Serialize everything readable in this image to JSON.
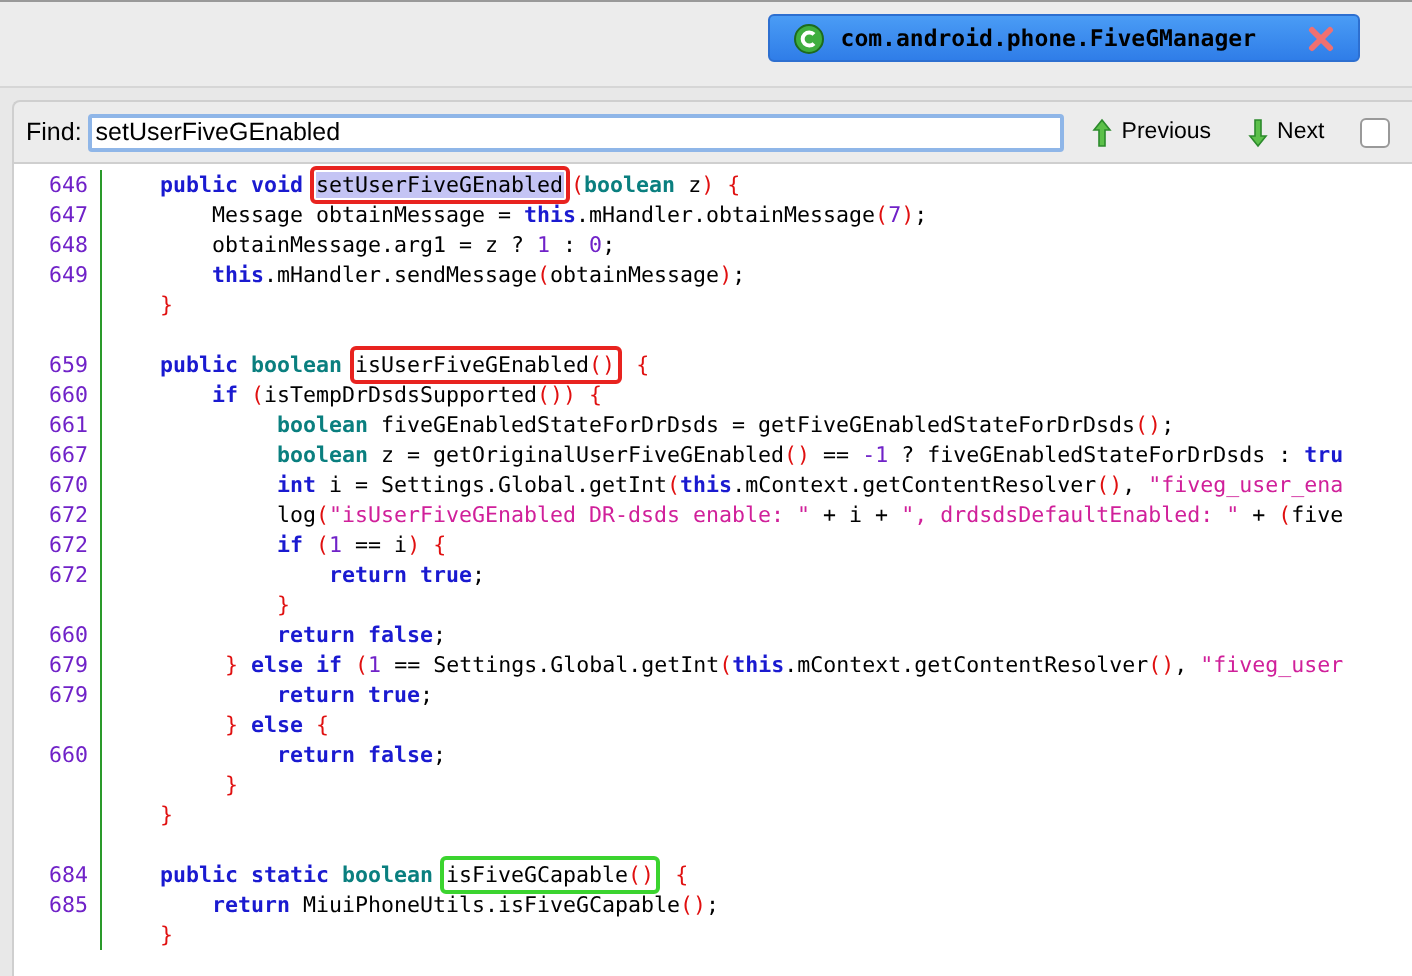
{
  "tabs": [
    {
      "label": "com.android.phone.FiveGManager",
      "selected": true
    }
  ],
  "find_bar": {
    "label": "Find:",
    "value": "setUserFiveGEnabled",
    "previous": "Previous",
    "next": "Next",
    "checkbox": {
      "checked": false
    }
  },
  "code_lines": [
    {
      "number": "646",
      "tokens": [
        {
          "text": "    public void ",
          "kind": "kw"
        },
        {
          "kind": "box",
          "color": "#e8231f",
          "children": [
            {
              "text": "setUserFiveGEnabled",
              "kind": "match"
            }
          ]
        },
        {
          "text": "(",
          "kind": "punct"
        },
        {
          "text": "boolean",
          "kind": "type"
        },
        {
          "text": " z",
          "kind": "plain"
        },
        {
          "text": ")",
          "kind": "punct"
        },
        {
          "text": " {",
          "kind": "punct"
        }
      ]
    },
    {
      "number": "647",
      "tokens": [
        {
          "text": "        Message obtainMessage = ",
          "kind": "plain"
        },
        {
          "text": "this",
          "kind": "kw"
        },
        {
          "text": ".mHandler.obtainMessage",
          "kind": "plain"
        },
        {
          "text": "(",
          "kind": "punct"
        },
        {
          "text": "7",
          "kind": "num"
        },
        {
          "text": ")",
          "kind": "punct"
        },
        {
          "text": ";",
          "kind": "plain"
        }
      ]
    },
    {
      "number": "648",
      "tokens": [
        {
          "text": "        obtainMessage.arg1 = z ? ",
          "kind": "plain"
        },
        {
          "text": "1",
          "kind": "num"
        },
        {
          "text": " : ",
          "kind": "plain"
        },
        {
          "text": "0",
          "kind": "num"
        },
        {
          "text": ";",
          "kind": "plain"
        }
      ]
    },
    {
      "number": "649",
      "tokens": [
        {
          "text": "        this",
          "kind": "kw"
        },
        {
          "text": ".mHandler.sendMessage",
          "kind": "plain"
        },
        {
          "text": "(",
          "kind": "punct"
        },
        {
          "text": "obtainMessage",
          "kind": "plain"
        },
        {
          "text": ")",
          "kind": "punct"
        },
        {
          "text": ";",
          "kind": "plain"
        }
      ]
    },
    {
      "tokens": [
        {
          "text": "    }",
          "kind": "punct"
        }
      ]
    },
    {
      "kind": "blank"
    },
    {
      "number": "659",
      "tokens": [
        {
          "text": "    public ",
          "kind": "kw"
        },
        {
          "text": "boolean ",
          "kind": "type"
        },
        {
          "kind": "box",
          "color": "#e8231f",
          "children": [
            {
              "text": "isUserFiveGEnabled",
              "kind": "plain"
            },
            {
              "text": "()",
              "kind": "punct"
            }
          ]
        },
        {
          "text": " {",
          "kind": "punct"
        }
      ]
    },
    {
      "number": "660",
      "tokens": [
        {
          "text": "        if ",
          "kind": "kw"
        },
        {
          "text": "(",
          "kind": "punct"
        },
        {
          "text": "isTempDrDsdsSupported",
          "kind": "plain"
        },
        {
          "text": "()) {",
          "kind": "punct"
        }
      ]
    },
    {
      "number": "661",
      "tokens": [
        {
          "text": "             boolean",
          "kind": "type"
        },
        {
          "text": " fiveGEnabledStateForDrDsds = getFiveGEnabledStateForDrDsds",
          "kind": "plain"
        },
        {
          "text": "()",
          "kind": "punct"
        },
        {
          "text": ";",
          "kind": "plain"
        }
      ]
    },
    {
      "number": "667",
      "tokens": [
        {
          "text": "             boolean",
          "kind": "type"
        },
        {
          "text": " z = getOriginalUserFiveGEnabled",
          "kind": "plain"
        },
        {
          "text": "()",
          "kind": "punct"
        },
        {
          "text": " == ",
          "kind": "plain"
        },
        {
          "text": "-1",
          "kind": "num"
        },
        {
          "text": " ? fiveGEnabledStateForDrDsds : ",
          "kind": "plain"
        },
        {
          "text": "tru",
          "kind": "kw"
        }
      ]
    },
    {
      "number": "670",
      "tokens": [
        {
          "text": "             int",
          "kind": "kw"
        },
        {
          "text": " i = Settings.Global.getInt",
          "kind": "plain"
        },
        {
          "text": "(",
          "kind": "punct"
        },
        {
          "text": "this",
          "kind": "kw"
        },
        {
          "text": ".mContext.getContentResolver",
          "kind": "plain"
        },
        {
          "text": "()",
          "kind": "punct"
        },
        {
          "text": ", ",
          "kind": "plain"
        },
        {
          "text": "\"fiveg_user_ena",
          "kind": "str"
        }
      ]
    },
    {
      "number": "672",
      "tokens": [
        {
          "text": "             log",
          "kind": "plain"
        },
        {
          "text": "(",
          "kind": "punct"
        },
        {
          "text": "\"isUserFiveGEnabled DR-dsds enable: \"",
          "kind": "str"
        },
        {
          "text": " + i + ",
          "kind": "plain"
        },
        {
          "text": "\", drdsdsDefaultEnabled: \"",
          "kind": "str"
        },
        {
          "text": " + ",
          "kind": "plain"
        },
        {
          "text": "(",
          "kind": "punct"
        },
        {
          "text": "five",
          "kind": "plain"
        }
      ]
    },
    {
      "number": "672",
      "tokens": [
        {
          "text": "             if ",
          "kind": "kw"
        },
        {
          "text": "(",
          "kind": "punct"
        },
        {
          "text": "1",
          "kind": "num"
        },
        {
          "text": " == i",
          "kind": "plain"
        },
        {
          "text": ")",
          "kind": "punct"
        },
        {
          "text": " {",
          "kind": "punct"
        }
      ]
    },
    {
      "number": "672",
      "tokens": [
        {
          "text": "                 return true",
          "kind": "kw"
        },
        {
          "text": ";",
          "kind": "plain"
        }
      ]
    },
    {
      "tokens": [
        {
          "text": "             }",
          "kind": "punct"
        }
      ]
    },
    {
      "number": "660",
      "tokens": [
        {
          "text": "             return false",
          "kind": "kw"
        },
        {
          "text": ";",
          "kind": "plain"
        }
      ]
    },
    {
      "number": "679",
      "tokens": [
        {
          "text": "         } ",
          "kind": "punct"
        },
        {
          "text": "else if ",
          "kind": "kw"
        },
        {
          "text": "(",
          "kind": "punct"
        },
        {
          "text": "1",
          "kind": "num"
        },
        {
          "text": " == Settings.Global.getInt",
          "kind": "plain"
        },
        {
          "text": "(",
          "kind": "punct"
        },
        {
          "text": "this",
          "kind": "kw"
        },
        {
          "text": ".mContext.getContentResolver",
          "kind": "plain"
        },
        {
          "text": "()",
          "kind": "punct"
        },
        {
          "text": ", ",
          "kind": "plain"
        },
        {
          "text": "\"fiveg_user",
          "kind": "str"
        }
      ]
    },
    {
      "number": "679",
      "tokens": [
        {
          "text": "             return true",
          "kind": "kw"
        },
        {
          "text": ";",
          "kind": "plain"
        }
      ]
    },
    {
      "tokens": [
        {
          "text": "         } ",
          "kind": "punct"
        },
        {
          "text": "else ",
          "kind": "kw"
        },
        {
          "text": "{",
          "kind": "punct"
        }
      ]
    },
    {
      "number": "660",
      "tokens": [
        {
          "text": "             return false",
          "kind": "kw"
        },
        {
          "text": ";",
          "kind": "plain"
        }
      ]
    },
    {
      "tokens": [
        {
          "text": "         }",
          "kind": "punct"
        }
      ]
    },
    {
      "tokens": [
        {
          "text": "    }",
          "kind": "punct"
        }
      ]
    },
    {
      "kind": "blank"
    },
    {
      "number": "684",
      "tokens": [
        {
          "text": "    public static ",
          "kind": "kw"
        },
        {
          "text": "boolean ",
          "kind": "type"
        },
        {
          "kind": "box",
          "color": "#3bd42f",
          "children": [
            {
              "text": "isFiveGCapable",
              "kind": "plain"
            },
            {
              "text": "()",
              "kind": "punct"
            }
          ]
        },
        {
          "text": " {",
          "kind": "punct"
        }
      ]
    },
    {
      "number": "685",
      "tokens": [
        {
          "text": "        return",
          "kind": "kw"
        },
        {
          "text": " MiuiPhoneUtils.isFiveGCapable",
          "kind": "plain"
        },
        {
          "text": "()",
          "kind": "punct"
        },
        {
          "text": ";",
          "kind": "plain"
        }
      ]
    },
    {
      "tokens": [
        {
          "text": "    }",
          "kind": "punct"
        }
      ]
    }
  ]
}
